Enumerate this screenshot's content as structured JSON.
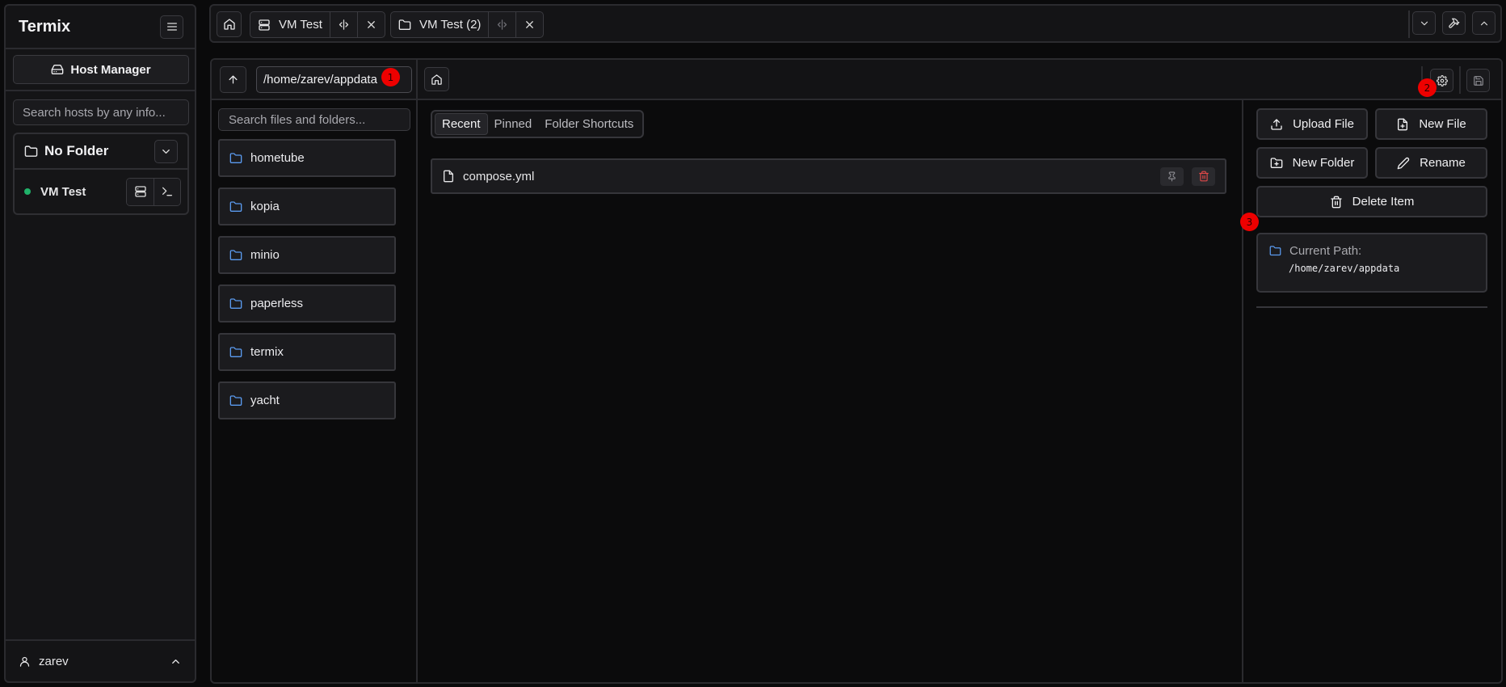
{
  "sidebar": {
    "title": "Termix",
    "host_manager_label": "Host Manager",
    "search_placeholder": "Search hosts by any info...",
    "folder": {
      "name": "No Folder",
      "hosts": [
        {
          "name": "VM Test",
          "status": "online"
        }
      ]
    },
    "user": "zarev"
  },
  "topbar": {
    "tabs": [
      {
        "label": "VM Test",
        "icon": "server-icon"
      },
      {
        "label": "VM Test (2)",
        "icon": "folder-icon"
      }
    ]
  },
  "file_manager": {
    "path_value": "/home/zarev/appdata",
    "search_placeholder": "Search files and folders...",
    "folders": [
      "hometube",
      "kopia",
      "minio",
      "paperless",
      "termix",
      "yacht"
    ],
    "view_tabs": [
      "Recent",
      "Pinned",
      "Folder Shortcuts"
    ],
    "active_view_tab": "Recent",
    "recent_files": [
      "compose.yml"
    ],
    "actions": {
      "upload_file": "Upload File",
      "new_file": "New File",
      "new_folder": "New Folder",
      "rename": "Rename",
      "delete_item": "Delete Item"
    },
    "current_path_label": "Current Path:",
    "current_path_value": "/home/zarev/appdata"
  },
  "badges": [
    "1",
    "2",
    "3"
  ],
  "colors": {
    "accent_folder": "#5b9bf0",
    "status_online": "#20b26a",
    "danger": "#e04848",
    "badge": "#ee0000"
  }
}
